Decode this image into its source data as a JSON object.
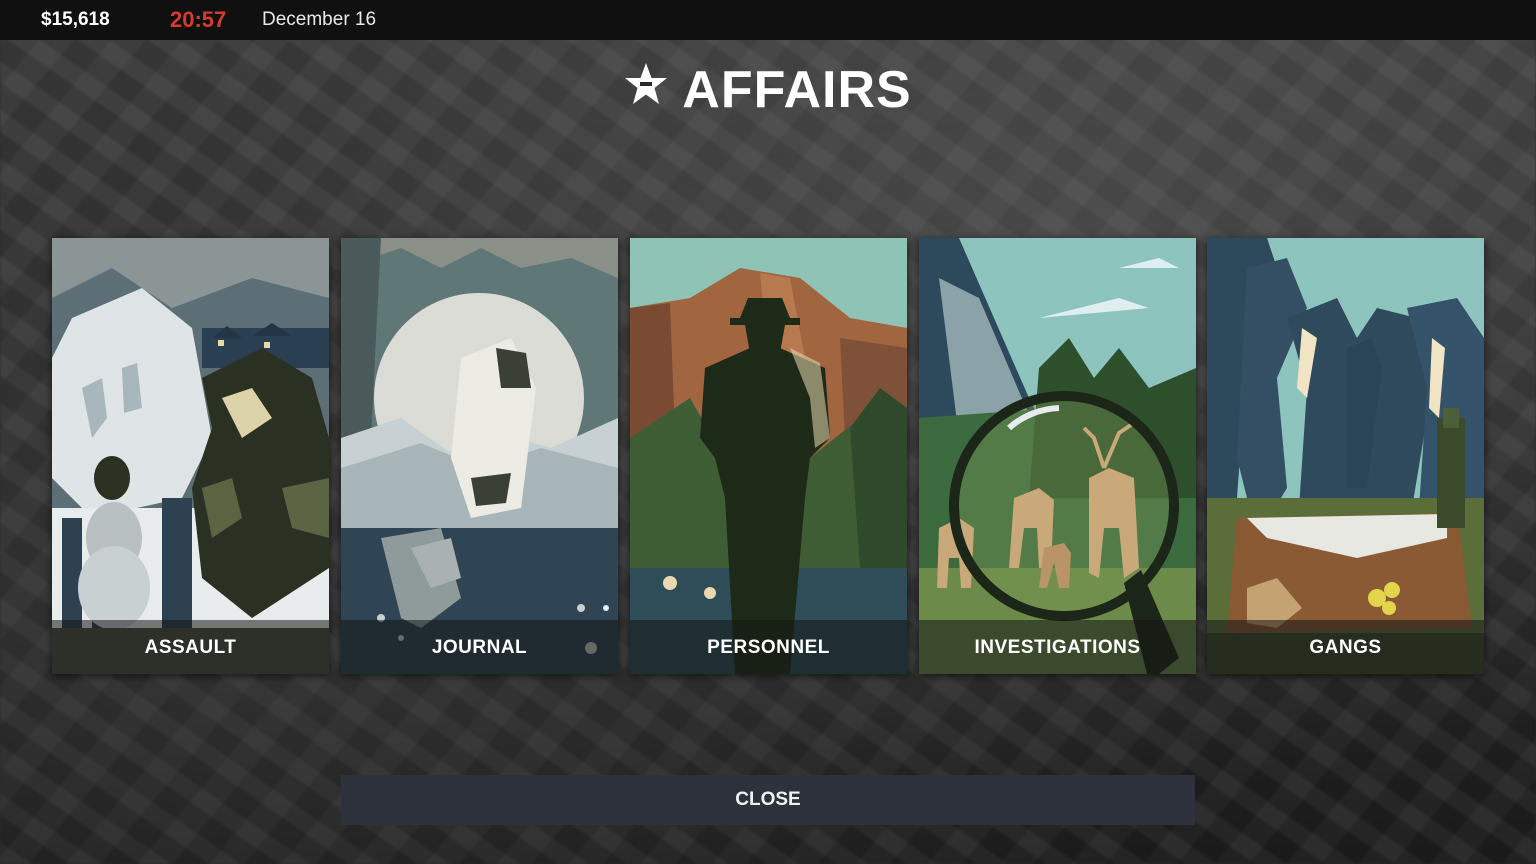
{
  "hud": {
    "money": "$15,618",
    "time": "20:57",
    "date": "December 16"
  },
  "screen": {
    "title": "AFFAIRS",
    "title_icon": "star-badge-icon"
  },
  "cards": [
    {
      "label": "ASSAULT"
    },
    {
      "label": "JOURNAL"
    },
    {
      "label": "PERSONNEL"
    },
    {
      "label": "INVESTIGATIONS"
    },
    {
      "label": "GANGS"
    }
  ],
  "close_label": "CLOSE",
  "colors": {
    "clock": "#d83a33",
    "close_button": "#2d313c"
  }
}
